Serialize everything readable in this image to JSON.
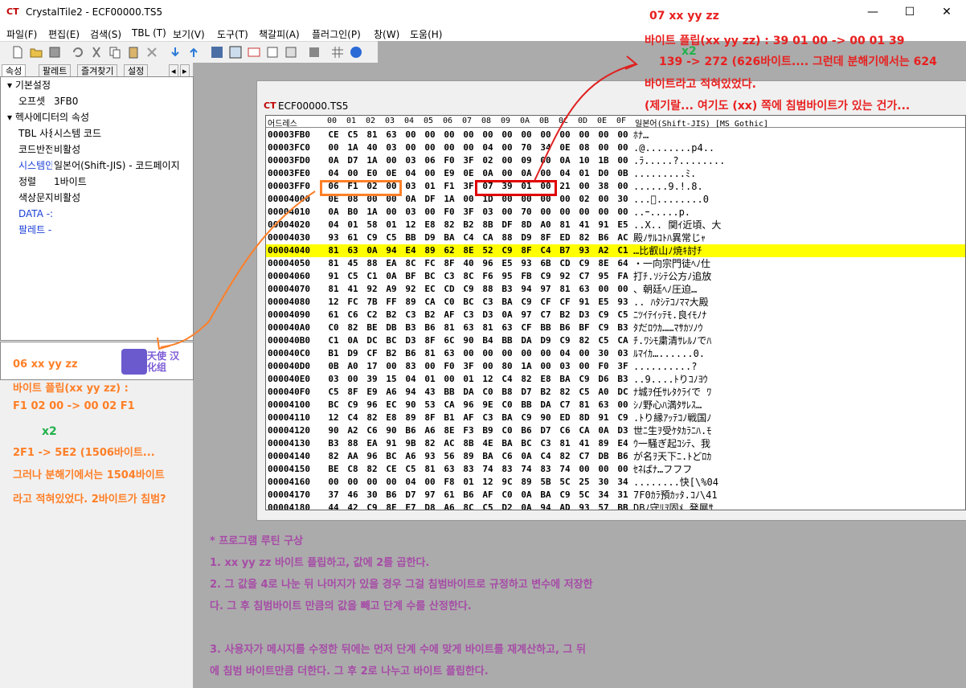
{
  "window": {
    "title": "CrystalTile2 - ECF00000.TS5",
    "icon": "app-logo-icon",
    "minimize": "—",
    "maximize": "☐",
    "close": "✕"
  },
  "menu": [
    "파일(F)",
    "편집(E)",
    "검색(S)",
    "TBL (T)",
    "보기(V)",
    "도구(T)",
    "책갈피(A)",
    "플러그인(P)",
    "창(W)",
    "도움(H)"
  ],
  "panel": {
    "tabs": [
      "속성",
      "팔레트",
      "즐겨찾기",
      "설정"
    ],
    "categories": [
      {
        "label": "기본설정",
        "rows": [
          {
            "key": "오프셋",
            "value": "3FB0"
          }
        ]
      },
      {
        "label": "헥사에디터의 속성",
        "rows": [
          {
            "key": "TBL 사용",
            "value": "시스템 코드"
          },
          {
            "key": "코드반전",
            "value": "비활성"
          },
          {
            "key": "시스템인",
            "value": "일본어(Shift-JIS)    - 코드페이지"
          },
          {
            "key": "정렬",
            "value": "1바이트"
          },
          {
            "key": "색상문자",
            "value": "비활성"
          },
          {
            "key": "DATA -:",
            "value": ""
          },
          {
            "key": "팔레트 -",
            "value": ""
          }
        ]
      }
    ],
    "logo_text": "天使 汉化组"
  },
  "hexwin": {
    "title": "ECF00000.TS5",
    "header": {
      "addr": "어드레스",
      "cols": [
        "00",
        "01",
        "02",
        "03",
        "04",
        "05",
        "06",
        "07",
        "08",
        "09",
        "0A",
        "0B",
        "0C",
        "0D",
        "0E",
        "0F"
      ],
      "text": "일본어(Shift-JIS) [MS Gothic]"
    },
    "rows": [
      {
        "a": "00003FB0",
        "b": [
          "CE",
          "C5",
          "81",
          "63",
          "00",
          "00",
          "00",
          "00",
          "00",
          "00",
          "00",
          "00",
          "00",
          "00",
          "00",
          "00"
        ],
        "t": "ﾎﾅ…"
      },
      {
        "a": "00003FC0",
        "b": [
          "00",
          "1A",
          "40",
          "03",
          "00",
          "00",
          "00",
          "00",
          "04",
          "00",
          "70",
          "34",
          "0E",
          "08",
          "00",
          "00"
        ],
        "t": ".@........p4.."
      },
      {
        "a": "00003FD0",
        "b": [
          "0A",
          "D7",
          "1A",
          "00",
          "03",
          "06",
          "F0",
          "3F",
          "02",
          "00",
          "09",
          "00",
          "0A",
          "10",
          "1B",
          "00"
        ],
        "t": ".ﾗ.....?........"
      },
      {
        "a": "00003FE0",
        "b": [
          "04",
          "00",
          "E0",
          "0E",
          "04",
          "00",
          "E9",
          "0E",
          "0A",
          "00",
          "0A",
          "00",
          "04",
          "01",
          "D0",
          "0B"
        ],
        "t": ".........ﾐ."
      },
      {
        "a": "00003FF0",
        "b": [
          "06",
          "F1",
          "02",
          "00",
          "03",
          "01",
          "F1",
          "3F",
          "07",
          "39",
          "01",
          "00",
          "21",
          "00",
          "38",
          "00"
        ],
        "t": "......9.!.8."
      },
      {
        "a": "00004000",
        "b": [
          "0E",
          "08",
          "00",
          "00",
          "0A",
          "DF",
          "1A",
          "00",
          "1D",
          "00",
          "00",
          "00",
          "00",
          "02",
          "00",
          "30"
        ],
        "t": "...ﾟ........0"
      },
      {
        "a": "00004010",
        "b": [
          "0A",
          "B0",
          "1A",
          "00",
          "03",
          "00",
          "F0",
          "3F",
          "03",
          "00",
          "70",
          "00",
          "00",
          "00",
          "00",
          "00"
        ],
        "t": "..ｰ.....p."
      },
      {
        "a": "00004020",
        "b": [
          "04",
          "01",
          "58",
          "01",
          "12",
          "E8",
          "82",
          "B2",
          "8B",
          "DF",
          "8D",
          "A0",
          "81",
          "41",
          "91",
          "E5"
        ],
        "t": "..X.. 関ｲ近頃、大"
      },
      {
        "a": "00004030",
        "b": [
          "93",
          "61",
          "C9",
          "C5",
          "BB",
          "D9",
          "BA",
          "C4",
          "CA",
          "88",
          "D9",
          "8F",
          "ED",
          "82",
          "B6",
          "AC"
        ],
        "t": "殿ﾉｻﾙｺﾄﾊ異常じｬ"
      },
      {
        "a": "00004040",
        "b": [
          "81",
          "63",
          "0A",
          "94",
          "E4",
          "89",
          "62",
          "8E",
          "52",
          "C9",
          "8F",
          "C4",
          "B7",
          "93",
          "A2",
          "C1"
        ],
        "t": "…比叡山ﾉ焼ｷ討ﾁ",
        "hl": true
      },
      {
        "a": "00004050",
        "b": [
          "81",
          "45",
          "88",
          "EA",
          "8C",
          "FC",
          "8F",
          "40",
          "96",
          "E5",
          "93",
          "6B",
          "CD",
          "C9",
          "8E",
          "64"
        ],
        "t": "・一向宗門徒ﾍﾉ仕"
      },
      {
        "a": "00004060",
        "b": [
          "91",
          "C5",
          "C1",
          "0A",
          "BF",
          "BC",
          "C3",
          "8C",
          "F6",
          "95",
          "FB",
          "C9",
          "92",
          "C7",
          "95",
          "FA"
        ],
        "t": "打ﾁ.ｿｼﾃ公方ﾉ追放"
      },
      {
        "a": "00004070",
        "b": [
          "81",
          "41",
          "92",
          "A9",
          "92",
          "EC",
          "CD",
          "C9",
          "88",
          "B3",
          "94",
          "97",
          "81",
          "63",
          "00",
          "00"
        ],
        "t": "、朝廷ﾍﾉ圧迫…"
      },
      {
        "a": "00004080",
        "b": [
          "12",
          "FC",
          "7B",
          "FF",
          "89",
          "CA",
          "C0",
          "BC",
          "C3",
          "BA",
          "C9",
          "CF",
          "CF",
          "91",
          "E5",
          "93"
        ],
        "t": ".. ﾊﾀｼﾃｺﾉﾏﾏ大殿"
      },
      {
        "a": "00004090",
        "b": [
          "61",
          "C6",
          "C2",
          "B2",
          "C3",
          "B2",
          "AF",
          "C3",
          "D3",
          "0A",
          "97",
          "C7",
          "B2",
          "D3",
          "C9",
          "C5"
        ],
        "t": "ﾆﾂｲﾃｲｯﾃﾓ.良ｲﾓﾉﾅ"
      },
      {
        "a": "000040A0",
        "b": [
          "C0",
          "82",
          "BE",
          "DB",
          "B3",
          "B6",
          "81",
          "63",
          "81",
          "63",
          "CF",
          "BB",
          "B6",
          "BF",
          "C9",
          "B3"
        ],
        "t": "ﾀだﾛｳｶ……ﾏｻｶｿﾉｳ"
      },
      {
        "a": "000040B0",
        "b": [
          "C1",
          "0A",
          "DC",
          "BC",
          "D3",
          "8F",
          "6C",
          "90",
          "B4",
          "BB",
          "DA",
          "D9",
          "C9",
          "82",
          "C5",
          "CA"
        ],
        "t": "ﾁ.ﾜｼﾓ粛清ｻﾚﾙﾉでﾊ"
      },
      {
        "a": "000040C0",
        "b": [
          "B1",
          "D9",
          "CF",
          "B2",
          "B6",
          "81",
          "63",
          "00",
          "00",
          "00",
          "00",
          "00",
          "04",
          "00",
          "30",
          "03"
        ],
        "t": "ﾙﾏｲｶ…......0."
      },
      {
        "a": "000040D0",
        "b": [
          "0B",
          "A0",
          "17",
          "00",
          "83",
          "00",
          "F0",
          "3F",
          "00",
          "80",
          "1A",
          "00",
          "03",
          "00",
          "F0",
          "3F"
        ],
        "t": "..........?"
      },
      {
        "a": "000040E0",
        "b": [
          "03",
          "00",
          "39",
          "15",
          "04",
          "01",
          "00",
          "01",
          "12",
          "C4",
          "82",
          "E8",
          "BA",
          "C9",
          "D6",
          "B3"
        ],
        "t": "..9....ﾄりｺﾉﾖｳ"
      },
      {
        "a": "000040F0",
        "b": [
          "C5",
          "8F",
          "E9",
          "A6",
          "94",
          "43",
          "BB",
          "DA",
          "C0",
          "B8",
          "D7",
          "B2",
          "82",
          "C5",
          "A0",
          "DC"
        ],
        "t": "ﾅ城ｦ任ｻﾚﾀｸﾗｲで ﾜ"
      },
      {
        "a": "00004100",
        "b": [
          "BC",
          "C9",
          "96",
          "EC",
          "90",
          "53",
          "CA",
          "96",
          "9E",
          "C0",
          "BB",
          "DA",
          "C7",
          "81",
          "63",
          "00"
        ],
        "t": "ｼﾉ野心ﾊ満ﾀｻﾚｽ…"
      },
      {
        "a": "00004110",
        "b": [
          "12",
          "C4",
          "82",
          "E8",
          "89",
          "8F",
          "B1",
          "AF",
          "C3",
          "BA",
          "C9",
          "90",
          "ED",
          "8D",
          "91",
          "C9"
        ],
        "t": ".ﾄり縁ｱｯﾃｺﾉ戦国ﾉ"
      },
      {
        "a": "00004120",
        "b": [
          "90",
          "A2",
          "C6",
          "90",
          "B6",
          "A6",
          "8E",
          "F3",
          "B9",
          "C0",
          "B6",
          "D7",
          "C6",
          "CA",
          "0A",
          "D3"
        ],
        "t": "世ﾆ生ｦ受ｹﾀｶﾗﾆﾊ.ﾓ"
      },
      {
        "a": "00004130",
        "b": [
          "B3",
          "88",
          "EA",
          "91",
          "9B",
          "82",
          "AC",
          "8B",
          "4E",
          "BA",
          "BC",
          "C3",
          "81",
          "41",
          "89",
          "E4"
        ],
        "t": "ｳ一騒ぎ起ｺｼﾃ、我"
      },
      {
        "a": "00004140",
        "b": [
          "82",
          "AA",
          "96",
          "BC",
          "A6",
          "93",
          "56",
          "89",
          "BA",
          "C6",
          "0A",
          "C4",
          "82",
          "C7",
          "DB",
          "B6"
        ],
        "t": "が名ｦ天下ﾆ.ﾄどﾛｶ"
      },
      {
        "a": "00004150",
        "b": [
          "BE",
          "C8",
          "82",
          "CE",
          "C5",
          "81",
          "63",
          "83",
          "74",
          "83",
          "74",
          "83",
          "74",
          "00",
          "00",
          "00"
        ],
        "t": "ｾﾈばﾅ…フフフ"
      },
      {
        "a": "00004160",
        "b": [
          "00",
          "00",
          "00",
          "00",
          "04",
          "00",
          "F8",
          "01",
          "12",
          "9C",
          "89",
          "5B",
          "5C",
          "25",
          "30",
          "34"
        ],
        "t": "........快[\\%04"
      },
      {
        "a": "00004170",
        "b": [
          "37",
          "46",
          "30",
          "B6",
          "D7",
          "97",
          "61",
          "B6",
          "AF",
          "C0",
          "0A",
          "BA",
          "C9",
          "5C",
          "34",
          "31"
        ],
        "t": "7F0ｶﾗ預ｶｯﾀ.ｺﾉ\\41"
      },
      {
        "a": "00004180",
        "b": [
          "44",
          "42",
          "C9",
          "8E",
          "E7",
          "D8",
          "A6",
          "8C",
          "C5",
          "D2",
          "0A",
          "94",
          "AD",
          "93",
          "57",
          "BB"
        ],
        "t": "DBﾉ守ﾘｦ固ﾒ.発展ｻ"
      }
    ]
  },
  "annotations": {
    "red": [
      "07 xx yy zz",
      "바이트 플립(xx yy zz) : 39 01 00 -> 00 01 39",
      "139 -> 272 (626바이트.... 그런데 분해기에서는 624",
      "바이트라고 적혀있었다.",
      "(제기랄... 여기도 (xx) 쪽에 침범바이트가 있는 건가..."
    ],
    "red_x2": "x2",
    "orange": [
      "06 xx yy zz",
      "바이트 플립(xx yy zz) :",
      "F1 02 00 -> 00 02 F1",
      "2F1 -> 5E2 (1506바이트...",
      "그러나 분해기에서는 1504바이트",
      "라고 적혀있었다. 2바이트가 침범?"
    ],
    "orange_x2": "x2",
    "purple": [
      "* 프로그램 루틴 구상",
      "1. xx yy zz 바이트 플립하고, 값에 2를 곱한다.",
      "2. 그 값을 4로 나눈 뒤 나머지가 있을 경우 그걸 침범바이트로 규정하고 변수에 저장한",
      "다. 그 후 침범바이트 만큼의 값을 빼고 단계 수를 산정한다.",
      "",
      "3. 사용자가 메시지를 수정한 뒤에는 먼저 단계 수에 맞게 바이트를 재계산하고, 그 뒤",
      "에 침범 바이트만큼 더한다. 그 후 2로 나누고 바이트 플립한다."
    ]
  },
  "colors": {
    "highlight_row": "#ffff00",
    "red": "#e00000",
    "orange": "#ff7f27",
    "purple": "#a64ca6",
    "green": "#22b14c",
    "cjk_block": "#7b7bf0"
  }
}
